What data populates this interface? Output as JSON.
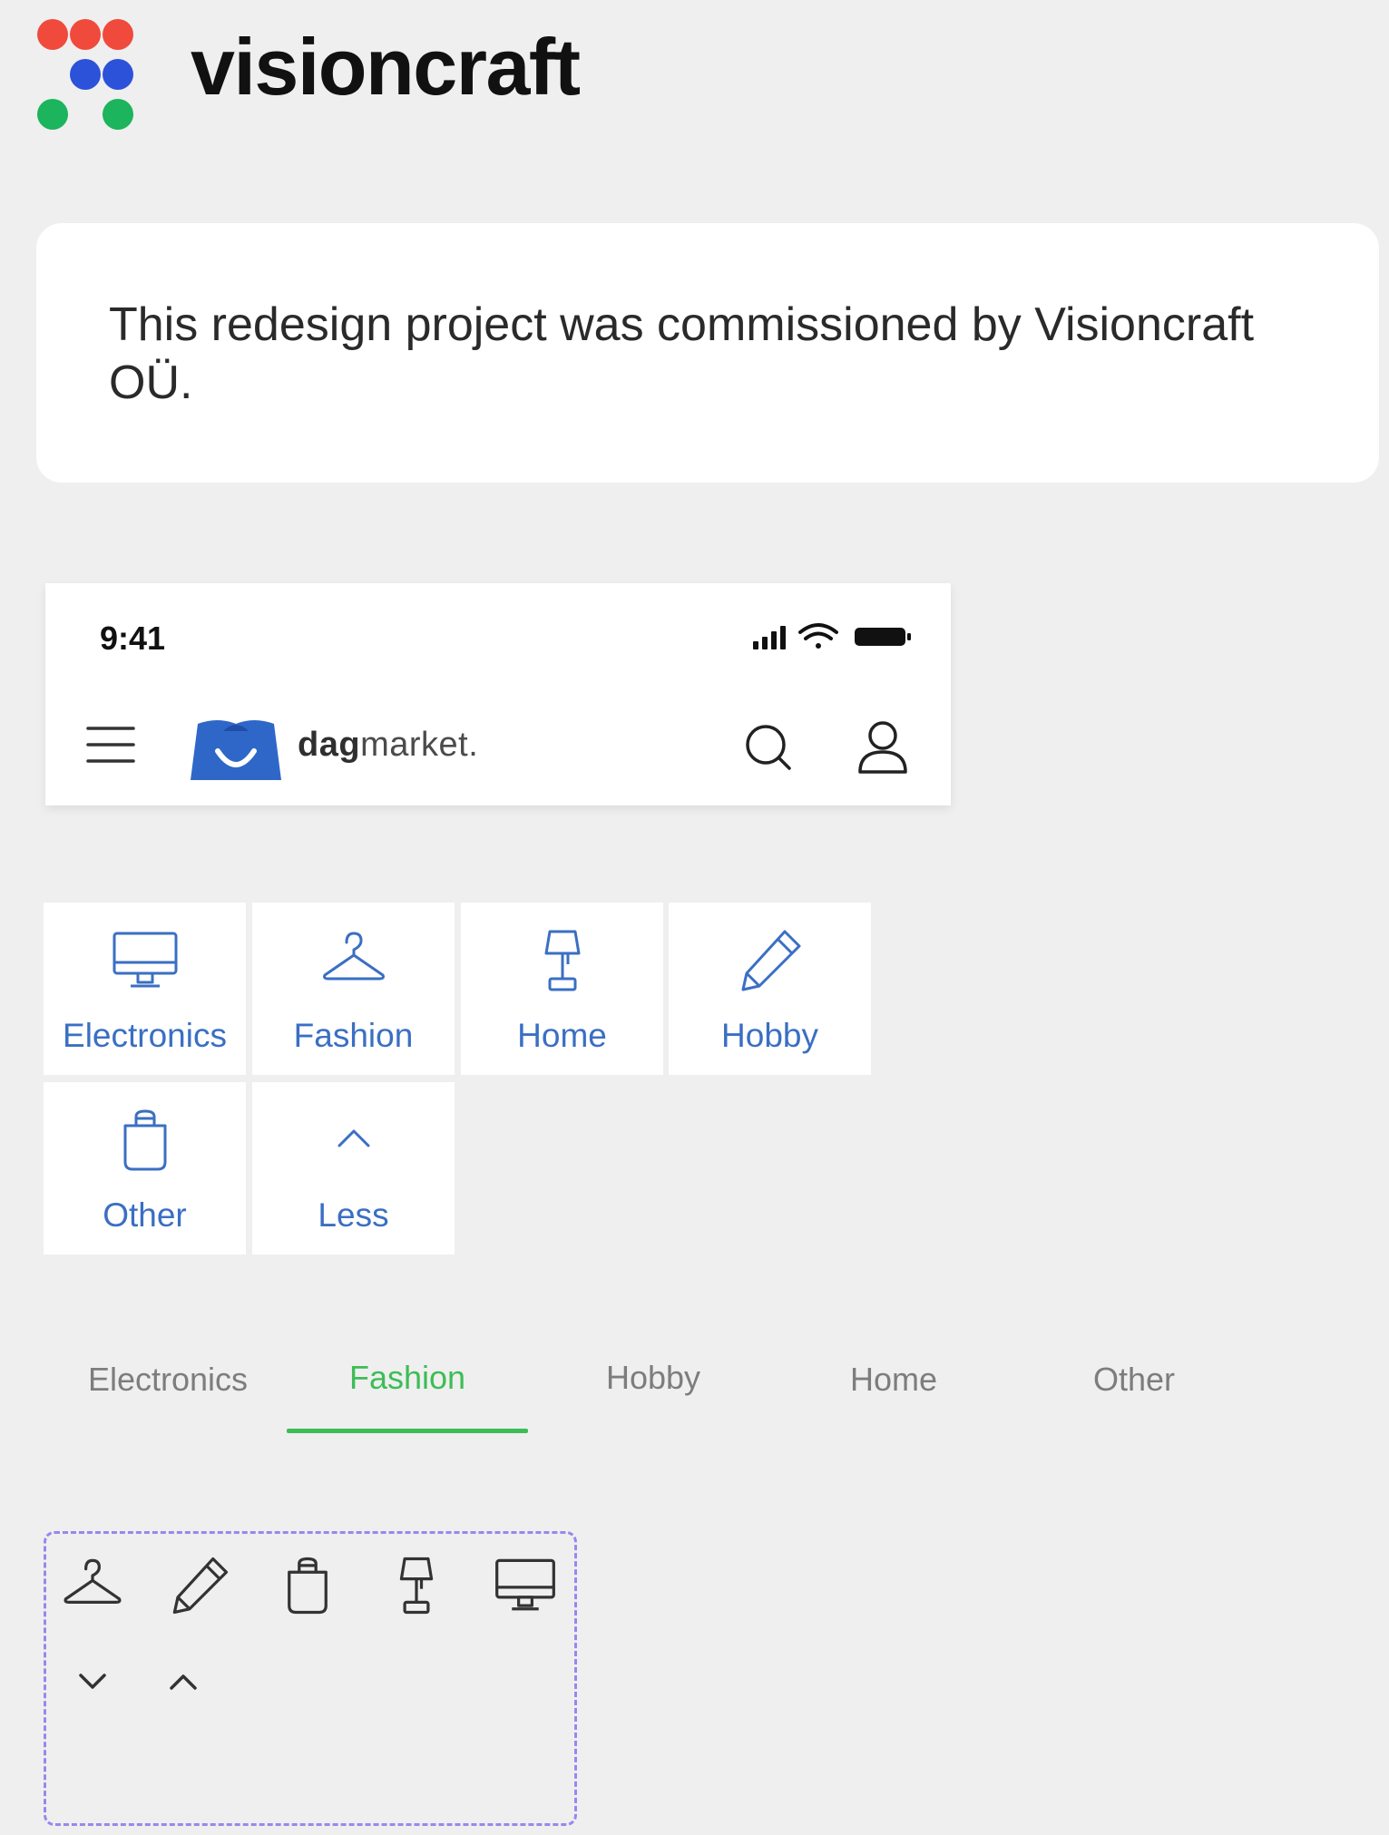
{
  "brand": {
    "name": "visioncraft",
    "logo_colors": [
      "#f04a3c",
      "#2c52d9",
      "#1cb45c"
    ]
  },
  "info": {
    "text": "This redesign project was commissioned by Visioncraft OÜ."
  },
  "phone_header": {
    "time": "9:41",
    "status_icons": [
      "signal-icon",
      "wifi-icon",
      "battery-icon"
    ],
    "app_name_bold": "dag",
    "app_name_rest": "market.",
    "menu_icon": "hamburger-menu-icon",
    "search_icon": "search-icon",
    "account_icon": "user-icon"
  },
  "categories": [
    {
      "label": "Electronics",
      "icon": "monitor-icon"
    },
    {
      "label": "Fashion",
      "icon": "hanger-icon"
    },
    {
      "label": "Home",
      "icon": "lamp-icon"
    },
    {
      "label": "Hobby",
      "icon": "pencil-icon"
    },
    {
      "label": "Other",
      "icon": "bag-icon"
    },
    {
      "label": "Less",
      "icon": "chevron-up-icon"
    }
  ],
  "tabs": {
    "items": [
      "Electronics",
      "Fashion",
      "Hobby",
      "Home",
      "Other"
    ],
    "active": "Fashion"
  },
  "icon_sheet": {
    "icons": [
      "hanger-icon",
      "pencil-icon",
      "bag-icon",
      "lamp-icon",
      "monitor-icon",
      "chevron-down-icon",
      "chevron-up-icon"
    ]
  },
  "colors": {
    "accent_blue": "#3a6fc3",
    "accent_green": "#3dbd56",
    "dashed_border": "#9b86ee",
    "page_bg": "#efefef"
  }
}
